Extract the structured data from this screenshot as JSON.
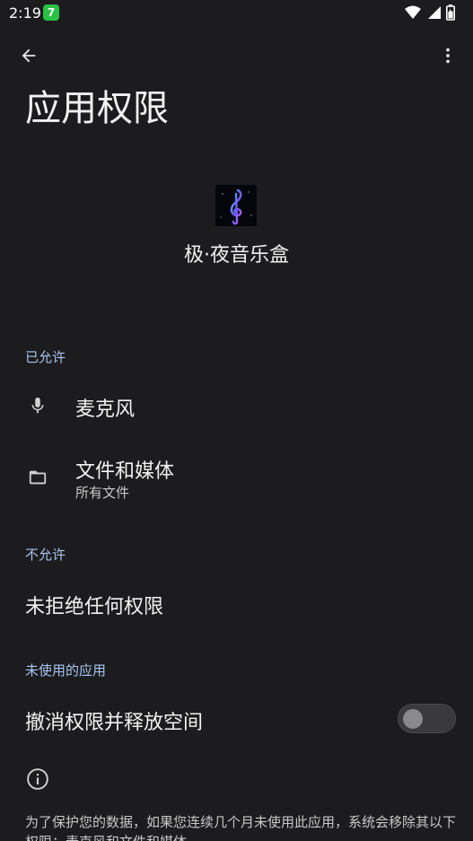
{
  "status_bar": {
    "time": "2:19",
    "badge": "7",
    "icons": [
      "wifi-icon",
      "signal-icon",
      "battery-icon"
    ]
  },
  "toolbar": {
    "back_icon": "arrow-back-icon",
    "more_icon": "more-vert-icon"
  },
  "page": {
    "title": "应用权限"
  },
  "app": {
    "name": "极·夜音乐盒",
    "icon": "music-note-icon"
  },
  "sections": {
    "allowed_header": "已允许",
    "not_allowed_header": "不允许",
    "unused_header": "未使用的应用"
  },
  "allowed_permissions": [
    {
      "title": "麦克风",
      "subtitle": "",
      "icon": "microphone-icon"
    },
    {
      "title": "文件和媒体",
      "subtitle": "所有文件",
      "icon": "folder-icon"
    }
  ],
  "not_allowed": {
    "text": "未拒绝任何权限"
  },
  "unused_apps": {
    "label": "撤消权限并释放空间",
    "toggle_on": false
  },
  "footer": {
    "icon": "info-icon",
    "text": "为了保护您的数据，如果您连续几个月未使用此应用，系统会移除其以下权限：麦克风和文件和媒体"
  },
  "colors": {
    "background": "#1c1c1e",
    "section_header": "#a9c5ef",
    "text_primary": "#f2f2f2",
    "badge": "#29c244"
  }
}
